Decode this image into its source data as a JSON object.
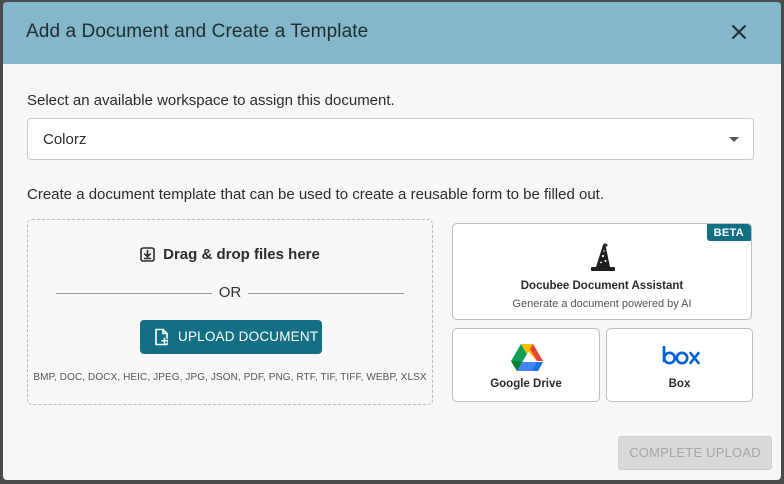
{
  "modal": {
    "title": "Add a Document and Create a Template",
    "close_icon": "close-icon"
  },
  "workspace": {
    "prompt": "Select an available workspace to assign this document.",
    "selected": "Colorz"
  },
  "template": {
    "prompt": "Create a document template that can be used to create a reusable form to be filled out."
  },
  "dropzone": {
    "drag_label": "Drag & drop files here",
    "or_label": "OR",
    "upload_label": "UPLOAD DOCUMENT",
    "formats": "BMP, DOC, DOCX, HEIC, JPEG, JPG, JSON, PDF, PNG, RTF, TIF, TIFF, WEBP, XLSX"
  },
  "sources": {
    "assistant": {
      "badge": "BETA",
      "title": "Docubee Document Assistant",
      "subtitle": "Generate a document powered by AI"
    },
    "google_drive": {
      "label": "Google Drive"
    },
    "box": {
      "label": "Box",
      "logo_text": "box"
    }
  },
  "footer": {
    "complete_label": "COMPLETE UPLOAD"
  },
  "colors": {
    "header_bg": "#83b7c9",
    "primary": "#126f84",
    "disabled_bg": "#d9d9d9",
    "box_blue": "#0061d5"
  }
}
